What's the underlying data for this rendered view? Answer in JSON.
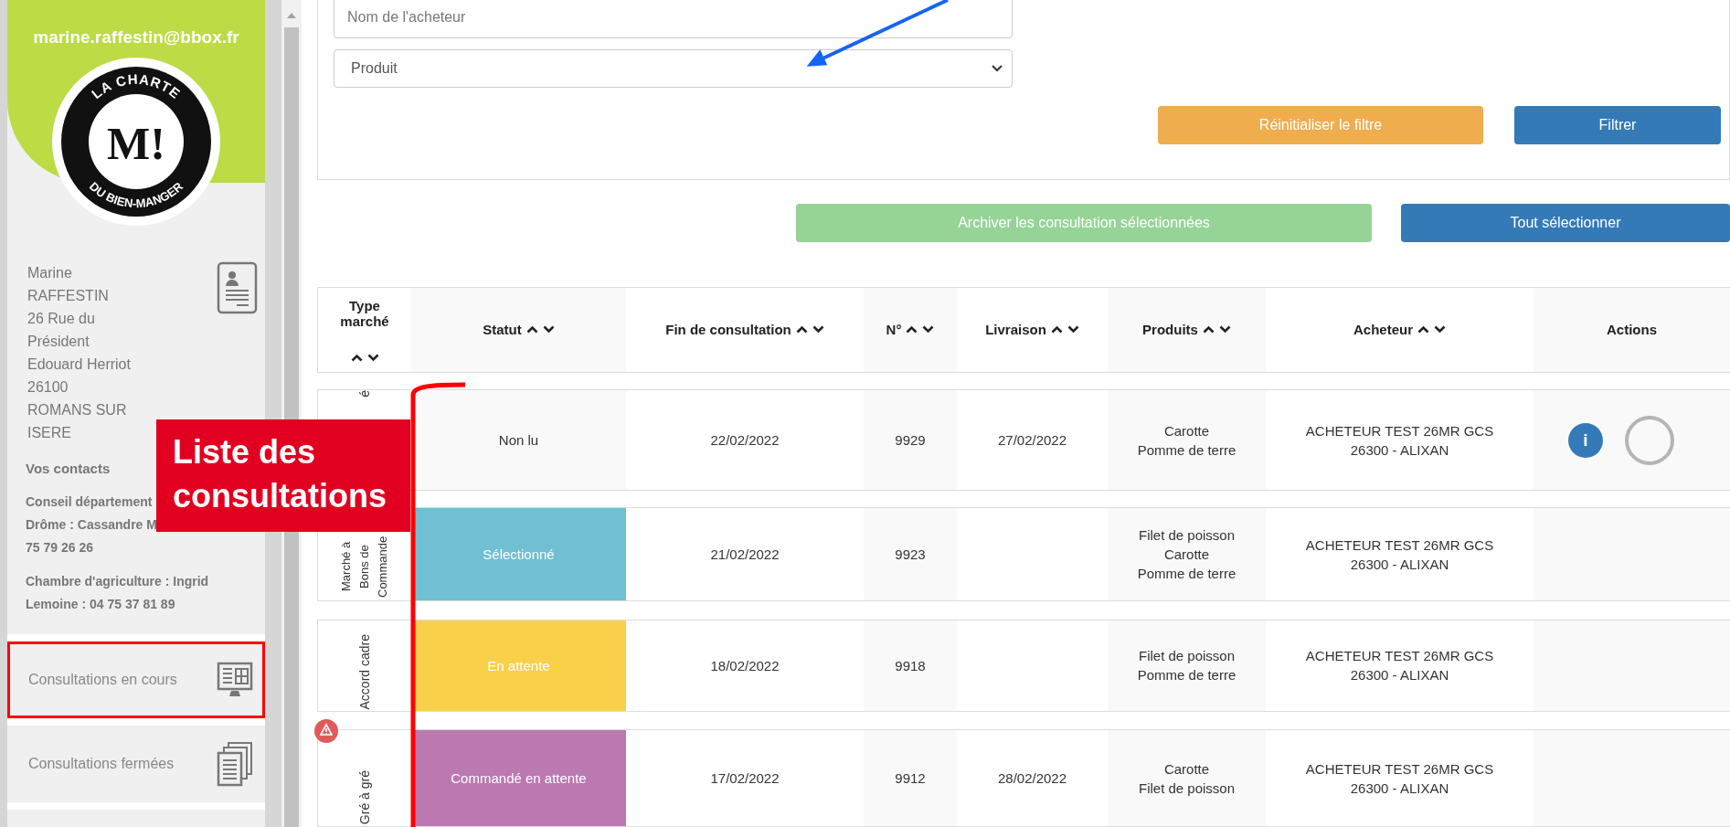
{
  "sidebar": {
    "email": "marine.raffestin@bbox.fr",
    "logo": {
      "top_text": "LA CHARTE",
      "mark": "M!",
      "bottom_text": "DU BIEN-MANGER"
    },
    "address_lines": [
      "Marine",
      "RAFFESTIN",
      "26 Rue du",
      "Président",
      "Edouard Herriot",
      "26100",
      "ROMANS SUR",
      "ISERE"
    ],
    "contacts_title": "Vos contacts",
    "contacts": [
      {
        "lines": [
          "Conseil département",
          "Drôme : Cassandre M",
          "75 79 26 26"
        ]
      },
      {
        "lines": [
          "Chambre d'agriculture : Ingrid",
          "Lemoine : 04 75 37 81 89"
        ]
      }
    ],
    "items": [
      {
        "label": "Consultations en cours",
        "kind": "monitor",
        "selected": true
      },
      {
        "label": "Consultations fermées",
        "kind": "documents",
        "selected": false
      },
      {
        "kind": "partial",
        "selected": false
      }
    ]
  },
  "filters": {
    "buyer": {
      "placeholder": "Nom de l'acheteur"
    },
    "product": {
      "value": "Produit"
    },
    "reset_button": "Réinitialiser le filtre",
    "filter_button": "Filtrer"
  },
  "actions": {
    "archive_button": "Archiver les consultation sélectionnées",
    "select_all_button": "Tout sélectionner"
  },
  "table": {
    "columns": [
      {
        "label": "Type marché",
        "sortable": true
      },
      {
        "label": "Statut",
        "sortable": true
      },
      {
        "label": "Fin de consultation",
        "sortable": true
      },
      {
        "label": "N°",
        "sortable": true
      },
      {
        "label": "Livraison",
        "sortable": true
      },
      {
        "label": "Produits",
        "sortable": true
      },
      {
        "label": "Acheteur",
        "sortable": true
      },
      {
        "label": "Actions",
        "sortable": false
      }
    ],
    "rows": [
      {
        "type": "é",
        "status": {
          "label": "Non lu",
          "color": "#f9f9f9"
        },
        "end": "22/02/2022",
        "number": "9929",
        "delivery": "27/02/2022",
        "products": [
          "Carotte",
          "Pomme de terre"
        ],
        "buyer": [
          "ACHETEUR TEST 26MR GCS",
          "26300 - ALIXAN"
        ],
        "info": "i",
        "warning": false
      },
      {
        "type": "Marché à Bons de Commande",
        "status": {
          "label": "Sélectionné",
          "color": "#70bfd3"
        },
        "end": "21/02/2022",
        "number": "9923",
        "products": [
          "Filet de poisson",
          "Carotte",
          "Pomme de terre"
        ],
        "buyer": [
          "ACHETEUR TEST 26MR GCS",
          "26300 - ALIXAN"
        ],
        "warning": false
      },
      {
        "type": "Accord cadre",
        "status": {
          "label": "En attente",
          "color": "#f9d049"
        },
        "end": "18/02/2022",
        "number": "9918",
        "products": [
          "Filet de poisson",
          "Pomme de terre"
        ],
        "buyer": [
          "ACHETEUR TEST 26MR GCS",
          "26300 - ALIXAN"
        ],
        "warning": false
      },
      {
        "type": "Gré à gré",
        "status": {
          "label": "Commandé en attente",
          "color": "#bb78b1"
        },
        "end": "17/02/2022",
        "number": "9912",
        "delivery": "28/02/2022",
        "products": [
          "Carotte",
          "Filet de poisson"
        ],
        "buyer": [
          "ACHETEUR TEST 26MR GCS",
          "26300 - ALIXAN"
        ],
        "warning": true
      }
    ]
  },
  "annotation": {
    "label": "Liste des consultations"
  }
}
